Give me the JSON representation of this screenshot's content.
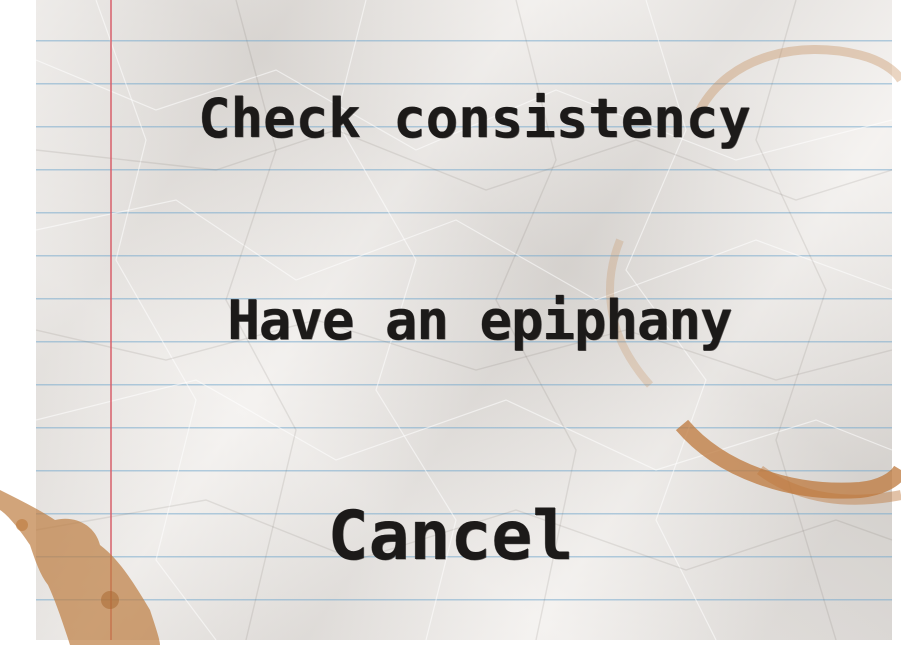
{
  "menu": {
    "items": [
      {
        "label": "Check consistency"
      },
      {
        "label": "Have an epiphany"
      },
      {
        "label": "Cancel"
      }
    ]
  },
  "colors": {
    "paper": "#ece8e4",
    "rule_line": "#78aacd",
    "margin_line": "#d75f69",
    "ink": "#1c1a19",
    "coffee_stain": "#c0824a"
  }
}
